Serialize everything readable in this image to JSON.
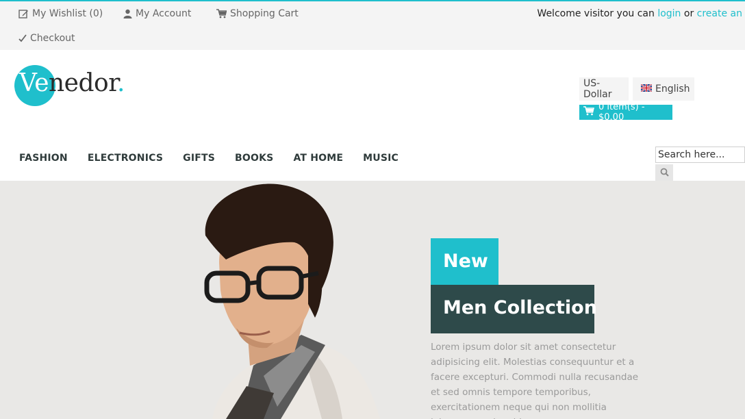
{
  "topbar": {
    "wishlist": "My Wishlist (0)",
    "account": "My Account",
    "cart": "Shopping Cart",
    "checkout": "Checkout",
    "welcome_text": "Welcome visitor you can",
    "login": "login",
    "or": "or",
    "create": "create an"
  },
  "header": {
    "logo_ve": "Ve",
    "logo_rest": "nedor",
    "logo_dot": ".",
    "currency": "US-Dollar",
    "language": "English",
    "cart_summary": "0 item(s) - $0.00"
  },
  "nav": {
    "items": [
      "FASHION",
      "ELECTRONICS",
      "GIFTS",
      "BOOKS",
      "AT HOME",
      "MUSIC"
    ]
  },
  "search": {
    "placeholder": "Search here..."
  },
  "banner": {
    "tag1": "New",
    "tag2": "Men Collection",
    "body": "Lorem ipsum dolor sit amet consectetur adipisicing elit. Molestias consequuntur et a facere excepturi. Commodi nulla recusandae et sed omnis tempore temporibus, exercitationem neque qui non mollitia laborum aperiam hic"
  },
  "colors": {
    "accent": "#1fbfcc",
    "dark_teal": "#2e4a4a",
    "banner_bg": "#e9e8e6"
  },
  "icons": [
    "edit-icon",
    "user-icon",
    "cart-icon",
    "check-icon",
    "uk-flag-icon",
    "search-icon"
  ]
}
